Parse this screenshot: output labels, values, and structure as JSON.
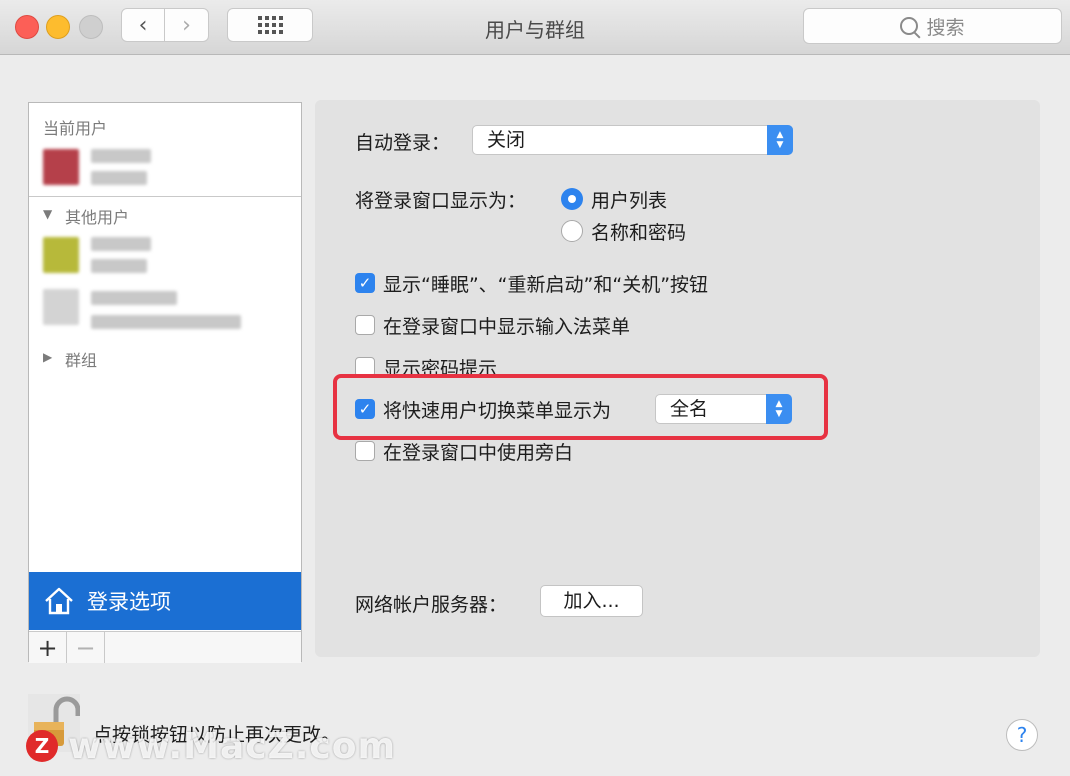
{
  "window": {
    "title": "用户与群组"
  },
  "toolbar": {
    "back_glyph": "‹",
    "forward_glyph": "›",
    "search_placeholder": "搜索"
  },
  "sidebar": {
    "current_user_label": "当前用户",
    "other_users_label": "其他用户",
    "groups_label": "群组",
    "login_options_label": "登录选项",
    "add_glyph": "+",
    "remove_glyph": "−"
  },
  "main": {
    "auto_login_label": "自动登录：",
    "auto_login_value": "关闭",
    "login_window_label": "将登录窗口显示为：",
    "radio_options": [
      {
        "label": "用户列表",
        "selected": true
      },
      {
        "label": "名称和密码",
        "selected": false
      }
    ],
    "checkboxes": [
      {
        "label": "显示“睡眠”、“重新启动”和“关机”按钮",
        "checked": true
      },
      {
        "label": "在登录窗口中显示输入法菜单",
        "checked": false
      },
      {
        "label": "显示密码提示",
        "checked": false
      },
      {
        "label": "将快速用户切换菜单显示为",
        "checked": true
      },
      {
        "label": "在登录窗口中使用旁白",
        "checked": false
      }
    ],
    "fast_switch_value": "全名",
    "network_server_label": "网络帐户服务器：",
    "join_button": "加入..."
  },
  "footer": {
    "lock_text": "点按锁按钮以防止再次更改。",
    "help_glyph": "?"
  },
  "watermark": {
    "badge": "Z",
    "text": "www.MacZ.com"
  },
  "colors": {
    "accent": "#2d83ee",
    "selection": "#1b6fd3",
    "highlight_box": "#e73242"
  }
}
